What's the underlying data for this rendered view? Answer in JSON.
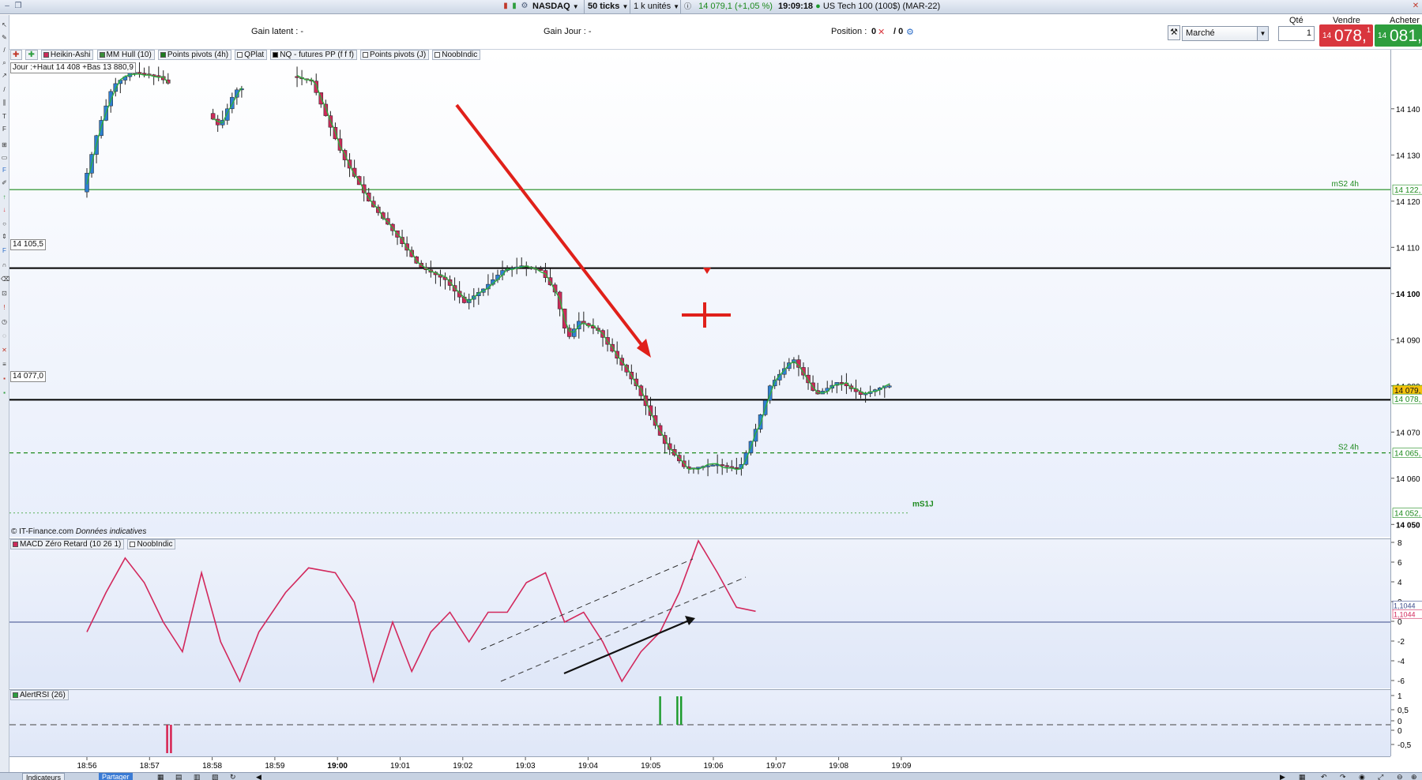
{
  "titlebar": {
    "instrument_market": "NASDAQ",
    "ticks": "50 ticks",
    "units": "1 k unités",
    "price_change": "14 079,1 (+1,05 %)",
    "time": "19:09:18",
    "instrument_name": "US Tech 100 (100$) (MAR-22)"
  },
  "infobar": {
    "gain_latent": "Gain latent : -",
    "gain_jour": "Gain Jour : -",
    "position_label": "Position :",
    "position_value_a": "0",
    "position_value_b": "/ 0"
  },
  "order": {
    "qty_header": "Qté",
    "sell_header": "Vendre",
    "buy_header": "Acheter",
    "order_type": "Marché",
    "qty_value": "1",
    "sell_small": "14",
    "sell_big": "078,",
    "sell_sup": "1",
    "buy_small": "14",
    "buy_big": "081,",
    "buy_sup": "1",
    "sell_color": "#d9363e",
    "buy_color": "#2e9e3e"
  },
  "indicators": [
    {
      "label": "Heikin-Ashi",
      "color": "#cc2a5a"
    },
    {
      "label": "MM Hull (10)",
      "color": "#3a8f3a"
    },
    {
      "label": "Points pivots (4h)",
      "color": "#1d7a1d"
    },
    {
      "label": "QPlat",
      "color": "#ffffff"
    },
    {
      "label": "NQ - futures PP (f f f)",
      "color": "#000000"
    },
    {
      "label": "Points pivots (J)",
      "color": "#ffffff"
    },
    {
      "label": "NoobIndic",
      "color": "#ffffff"
    }
  ],
  "info_boxes": {
    "jour": "Jour :+Haut 14 408  +Bas 13 880,9",
    "level_1": "14 105,5",
    "level_2": "14 077,0",
    "copyright": "© IT-Finance.com",
    "donnees": "Données indicatives"
  },
  "pivot_labels": {
    "ms2": "mS2 4h",
    "s2": "S2 4h",
    "ms1j": "mS1J"
  },
  "price_axis": {
    "ticks": [
      "14 140",
      "14 130",
      "14 120",
      "14 110",
      "14 100",
      "14 090",
      "14 080",
      "14 070",
      "14 060",
      "14 050"
    ],
    "tag_ms2": "14 122,",
    "tag_last": "14 079,",
    "tag_bid": "14 078,",
    "tag_s2": "14 065,",
    "tag_ms1j": "14 052,"
  },
  "macd_panel": {
    "label": "MACD Zéro Retard (10 26 1)",
    "label2": "NoobIndic",
    "ticks": [
      "8",
      "6",
      "4",
      "2",
      "0",
      "-2",
      "-4",
      "-6"
    ],
    "tag_value": "1,1044",
    "tag_value2": "1,1044"
  },
  "rsi_panel": {
    "label": "AlertRSI (26)",
    "ticks": [
      "1",
      "0,5",
      "0",
      "0",
      "-0,5"
    ]
  },
  "time_axis": {
    "labels": [
      "18:56",
      "18:57",
      "18:58",
      "18:59",
      "19:00",
      "19:01",
      "19:02",
      "19:03",
      "19:04",
      "19:05",
      "19:06",
      "19:07",
      "19:08",
      "19:09"
    ]
  },
  "bottom_bar": {
    "indicateurs": "Indicateurs",
    "partager": "Partager"
  },
  "chart_data": {
    "type": "candlestick",
    "x_labels": [
      "18:56",
      "18:57",
      "18:58",
      "18:59",
      "19:00",
      "19:01",
      "19:02",
      "19:03",
      "19:04",
      "19:05",
      "19:06",
      "19:07",
      "19:08",
      "19:09"
    ],
    "y_range": [
      14045,
      14148
    ],
    "horizontal_levels": [
      {
        "name": "mS2 4h",
        "value": 14122.5,
        "color": "#1d8a1d",
        "style": "solid"
      },
      {
        "name": "NQ PP",
        "value": 14105.5,
        "color": "#000000",
        "style": "solid"
      },
      {
        "name": "NQ PP",
        "value": 14077.0,
        "color": "#000000",
        "style": "solid"
      },
      {
        "name": "S2 4h",
        "value": 14065.5,
        "color": "#1d8a1d",
        "style": "dashed"
      },
      {
        "name": "mS1J",
        "value": 14052.5,
        "color": "#6bb86b",
        "style": "dotted"
      }
    ],
    "price_path": [
      [
        0.0,
        14122
      ],
      [
        0.04,
        14135
      ],
      [
        0.08,
        14145
      ],
      [
        0.13,
        14148
      ],
      [
        0.2,
        14147
      ],
      [
        0.32,
        14140
      ],
      [
        0.36,
        14136
      ],
      [
        0.4,
        14144
      ],
      [
        0.55,
        14147
      ],
      [
        0.6,
        14146
      ],
      [
        0.63,
        14140
      ],
      [
        0.68,
        14130
      ],
      [
        0.75,
        14120
      ],
      [
        0.8,
        14115
      ],
      [
        0.88,
        14106
      ],
      [
        0.95,
        14103
      ],
      [
        1.0,
        14098
      ],
      [
        1.05,
        14101
      ],
      [
        1.1,
        14105
      ],
      [
        1.15,
        14106
      ],
      [
        1.2,
        14105
      ],
      [
        1.24,
        14100
      ],
      [
        1.27,
        14090
      ],
      [
        1.3,
        14094
      ],
      [
        1.35,
        14092
      ],
      [
        1.45,
        14080
      ],
      [
        1.52,
        14068
      ],
      [
        1.58,
        14062
      ],
      [
        1.66,
        14063
      ],
      [
        1.72,
        14062
      ],
      [
        1.76,
        14070
      ],
      [
        1.8,
        14080
      ],
      [
        1.86,
        14086
      ],
      [
        1.92,
        14078
      ],
      [
        1.98,
        14081
      ],
      [
        2.04,
        14078
      ],
      [
        2.1,
        14080
      ]
    ],
    "macd_series": [
      [
        0.0,
        -1
      ],
      [
        0.05,
        3
      ],
      [
        0.1,
        6.5
      ],
      [
        0.15,
        4
      ],
      [
        0.2,
        0
      ],
      [
        0.25,
        -3
      ],
      [
        0.3,
        5
      ],
      [
        0.35,
        -2
      ],
      [
        0.4,
        -6
      ],
      [
        0.45,
        -1
      ],
      [
        0.52,
        3
      ],
      [
        0.58,
        5.5
      ],
      [
        0.65,
        5
      ],
      [
        0.7,
        2
      ],
      [
        0.75,
        -6
      ],
      [
        0.8,
        0
      ],
      [
        0.85,
        -5
      ],
      [
        0.9,
        -1
      ],
      [
        0.95,
        1
      ],
      [
        1.0,
        -2
      ],
      [
        1.05,
        1
      ],
      [
        1.1,
        1
      ],
      [
        1.15,
        4
      ],
      [
        1.2,
        5
      ],
      [
        1.25,
        0
      ],
      [
        1.3,
        1
      ],
      [
        1.35,
        -2
      ],
      [
        1.4,
        -6
      ],
      [
        1.45,
        -3
      ],
      [
        1.5,
        -1
      ],
      [
        1.55,
        3
      ],
      [
        1.6,
        9
      ],
      [
        1.65,
        5
      ],
      [
        1.7,
        1.5
      ],
      [
        1.75,
        1.1
      ]
    ],
    "rsi_alerts": [
      {
        "x": 0.21,
        "dir": "down",
        "color": "#d61a4a"
      },
      {
        "x": 0.22,
        "dir": "down",
        "color": "#d61a4a"
      },
      {
        "x": 1.5,
        "dir": "up",
        "color": "#1a9a2a"
      },
      {
        "x": 1.545,
        "dir": "up",
        "color": "#1a9a2a"
      },
      {
        "x": 1.555,
        "dir": "up",
        "color": "#1a9a2a"
      }
    ]
  }
}
